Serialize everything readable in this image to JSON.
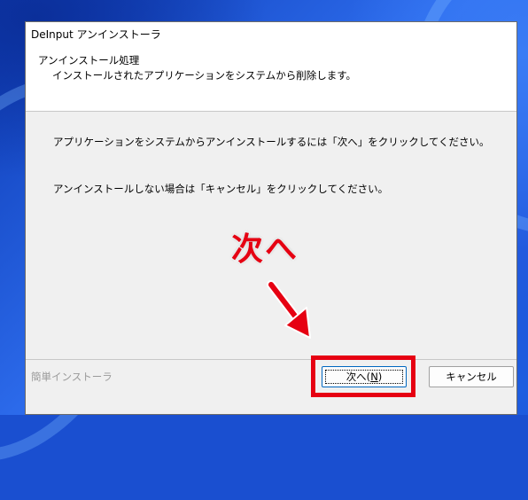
{
  "window": {
    "title": "DeInput アンインストーラ"
  },
  "header": {
    "title": "アンインストール処理",
    "subtitle": "インストールされたアプリケーションをシステムから削除します。"
  },
  "body": {
    "line1": "アプリケーションをシステムからアンインストールするには「次へ」をクリックしてください。",
    "line2": "アンインストールしない場合は「キャンセル」をクリックしてください。"
  },
  "footer": {
    "brand": "簡単インストーラ",
    "next_label": "次へ(",
    "next_accel": "N",
    "next_label_end": ")",
    "cancel_label": "キャンセル"
  },
  "annotation": {
    "text": "次へ",
    "color": "#e60012"
  }
}
